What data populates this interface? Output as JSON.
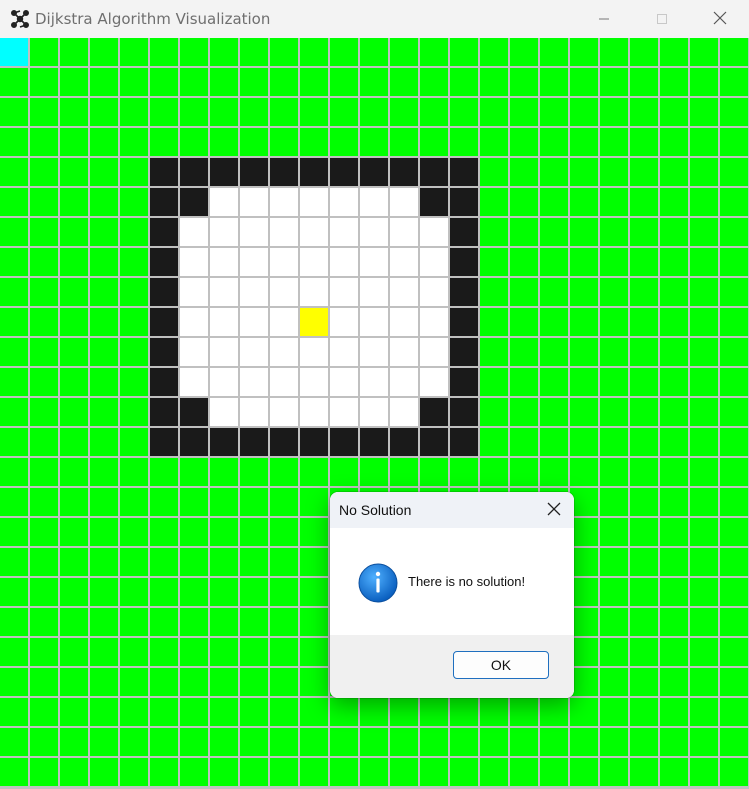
{
  "window": {
    "title": "Dijkstra Algorithm Visualization",
    "icon": "graph-network-icon",
    "controls": [
      "minimize-icon",
      "maximize-icon",
      "close-icon"
    ]
  },
  "grid": {
    "rows": 25,
    "cols": 25,
    "colors": {
      "open": "#00ff00",
      "wall": "#1a1a1a",
      "unvisited": "#ffffff",
      "start": "#00ffff",
      "end": "#ffff00",
      "line": "#c0c0c0"
    },
    "start": [
      0,
      0
    ],
    "end": [
      9,
      10
    ],
    "walls": [
      [
        4,
        5
      ],
      [
        4,
        6
      ],
      [
        4,
        7
      ],
      [
        4,
        8
      ],
      [
        4,
        9
      ],
      [
        4,
        10
      ],
      [
        4,
        11
      ],
      [
        4,
        12
      ],
      [
        4,
        13
      ],
      [
        4,
        14
      ],
      [
        4,
        15
      ],
      [
        5,
        5
      ],
      [
        5,
        6
      ],
      [
        5,
        14
      ],
      [
        5,
        15
      ],
      [
        6,
        5
      ],
      [
        6,
        15
      ],
      [
        7,
        5
      ],
      [
        7,
        15
      ],
      [
        8,
        5
      ],
      [
        8,
        15
      ],
      [
        9,
        5
      ],
      [
        9,
        15
      ],
      [
        10,
        5
      ],
      [
        10,
        15
      ],
      [
        11,
        5
      ],
      [
        11,
        15
      ],
      [
        12,
        5
      ],
      [
        12,
        6
      ],
      [
        12,
        14
      ],
      [
        12,
        15
      ],
      [
        13,
        5
      ],
      [
        13,
        6
      ],
      [
        13,
        7
      ],
      [
        13,
        8
      ],
      [
        13,
        9
      ],
      [
        13,
        10
      ],
      [
        13,
        11
      ],
      [
        13,
        12
      ],
      [
        13,
        13
      ],
      [
        13,
        14
      ],
      [
        13,
        15
      ]
    ],
    "enclosed": [
      [
        5,
        7
      ],
      [
        5,
        8
      ],
      [
        5,
        9
      ],
      [
        5,
        10
      ],
      [
        5,
        11
      ],
      [
        5,
        12
      ],
      [
        5,
        13
      ],
      [
        6,
        6
      ],
      [
        6,
        7
      ],
      [
        6,
        8
      ],
      [
        6,
        9
      ],
      [
        6,
        10
      ],
      [
        6,
        11
      ],
      [
        6,
        12
      ],
      [
        6,
        13
      ],
      [
        6,
        14
      ],
      [
        7,
        6
      ],
      [
        7,
        7
      ],
      [
        7,
        8
      ],
      [
        7,
        9
      ],
      [
        7,
        10
      ],
      [
        7,
        11
      ],
      [
        7,
        12
      ],
      [
        7,
        13
      ],
      [
        7,
        14
      ],
      [
        8,
        6
      ],
      [
        8,
        7
      ],
      [
        8,
        8
      ],
      [
        8,
        9
      ],
      [
        8,
        10
      ],
      [
        8,
        11
      ],
      [
        8,
        12
      ],
      [
        8,
        13
      ],
      [
        8,
        14
      ],
      [
        9,
        6
      ],
      [
        9,
        7
      ],
      [
        9,
        8
      ],
      [
        9,
        9
      ],
      [
        9,
        11
      ],
      [
        9,
        12
      ],
      [
        9,
        13
      ],
      [
        9,
        14
      ],
      [
        10,
        6
      ],
      [
        10,
        7
      ],
      [
        10,
        8
      ],
      [
        10,
        9
      ],
      [
        10,
        10
      ],
      [
        10,
        11
      ],
      [
        10,
        12
      ],
      [
        10,
        13
      ],
      [
        10,
        14
      ],
      [
        11,
        6
      ],
      [
        11,
        7
      ],
      [
        11,
        8
      ],
      [
        11,
        9
      ],
      [
        11,
        10
      ],
      [
        11,
        11
      ],
      [
        11,
        12
      ],
      [
        11,
        13
      ],
      [
        11,
        14
      ],
      [
        12,
        7
      ],
      [
        12,
        8
      ],
      [
        12,
        9
      ],
      [
        12,
        10
      ],
      [
        12,
        11
      ],
      [
        12,
        12
      ],
      [
        12,
        13
      ]
    ]
  },
  "dialog": {
    "title": "No Solution",
    "message": "There is no solution!",
    "icon": "info-icon",
    "ok_label": "OK"
  }
}
